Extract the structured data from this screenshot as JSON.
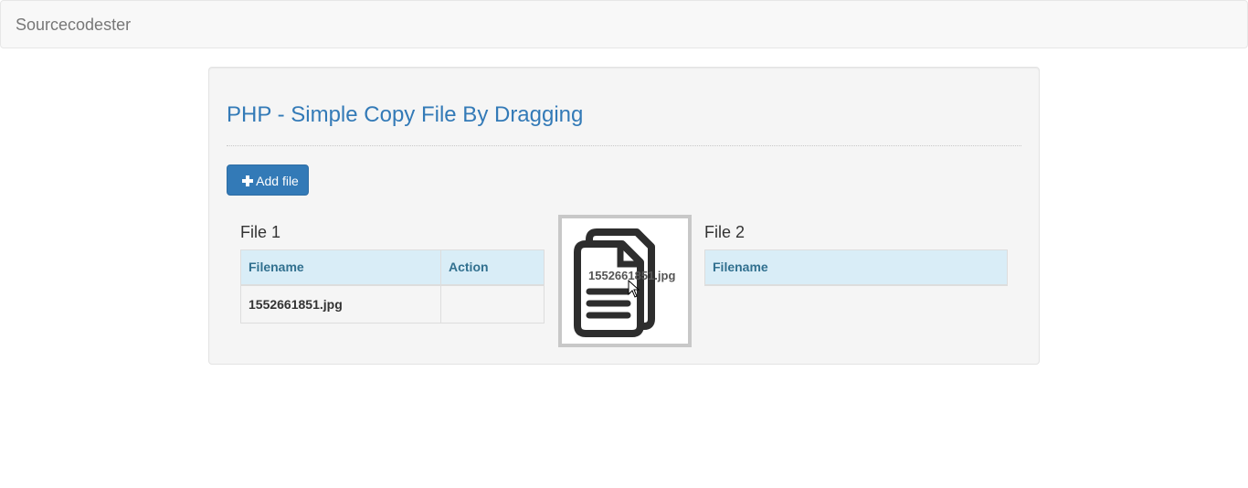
{
  "navbar": {
    "brand": "Sourcecodester"
  },
  "page": {
    "title": "PHP - Simple Copy File By Dragging",
    "add_button_label": "Add file"
  },
  "file1": {
    "heading": "File 1",
    "columns": [
      "Filename",
      "Action"
    ],
    "rows": [
      {
        "filename": "1552661851.jpg",
        "action": ""
      }
    ]
  },
  "file2": {
    "heading": "File 2",
    "columns": [
      "Filename"
    ],
    "rows": []
  },
  "drag": {
    "ghost_label": "1552661851.jpg",
    "icon": "copy-file-icon"
  },
  "colors": {
    "primary": "#337ab7",
    "table_header_bg": "#d9edf7",
    "table_header_text": "#31708f"
  }
}
